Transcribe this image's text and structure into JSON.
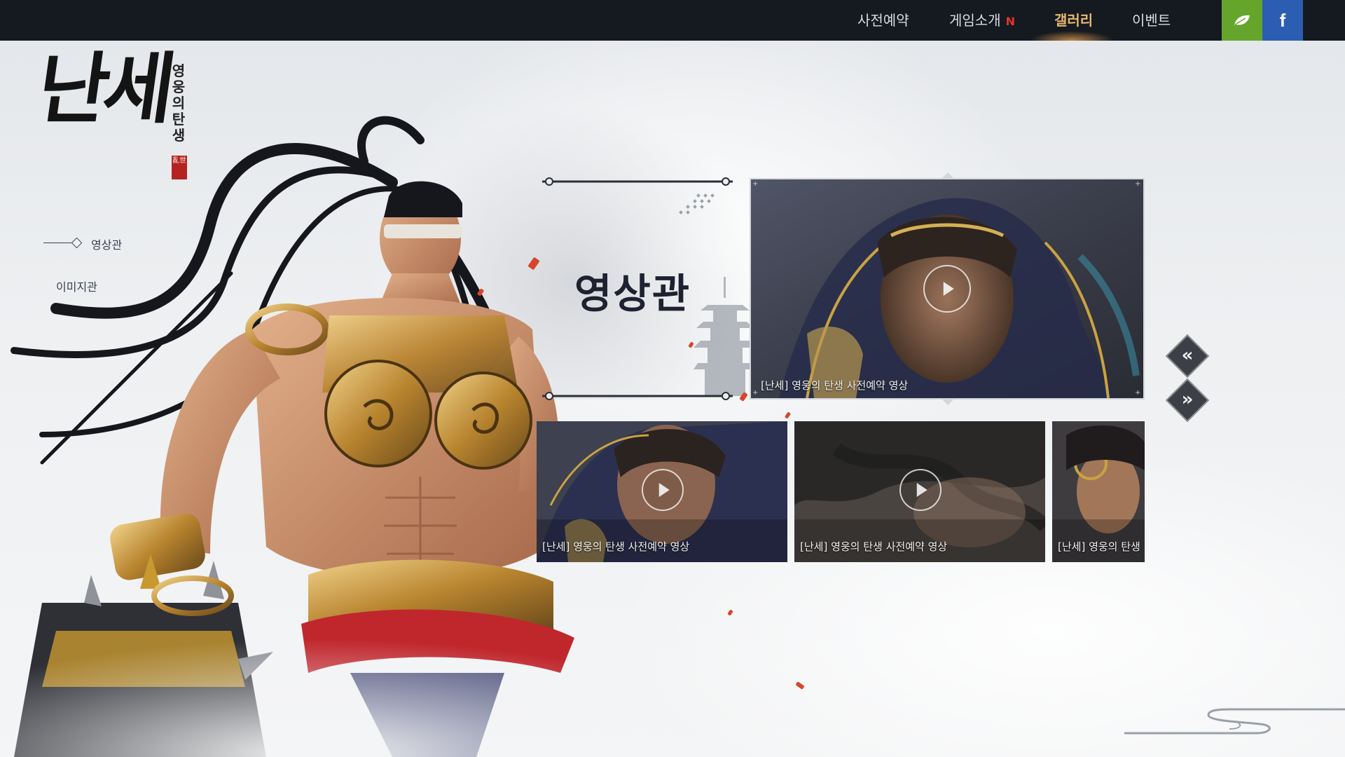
{
  "nav": {
    "items": [
      {
        "label": "사전예약"
      },
      {
        "label": "게임소개",
        "badge": "N"
      },
      {
        "label": "갤러리",
        "active": true
      },
      {
        "label": "이벤트"
      }
    ],
    "sns": [
      {
        "icon": "leaf-icon",
        "color": "#66a52c"
      },
      {
        "icon": "facebook-icon",
        "label": "f",
        "color": "#2b5db3"
      }
    ]
  },
  "logo": {
    "title": "난세",
    "subtitle": "영웅의탄생",
    "seal": "亂世"
  },
  "side_menu": {
    "items": [
      {
        "label": "영상관",
        "active": true
      },
      {
        "label": "이미지관",
        "active": false
      }
    ]
  },
  "section": {
    "title": "영상관"
  },
  "featured_video": {
    "caption": "[난세] 영웅의 탄생 사전예약 영상"
  },
  "carousel": {
    "prev_icon": "chevron-left-double-icon",
    "next_icon": "chevron-right-double-icon",
    "prev_glyph": "«",
    "next_glyph": "»"
  },
  "thumbnails": [
    {
      "caption": "[난세] 영웅의 탄생 사전예약 영상"
    },
    {
      "caption": "[난세] 영웅의 탄생 사전예약 영상"
    },
    {
      "caption": "[난세] 영웅의 탄생"
    }
  ],
  "colors": {
    "topbar": "#151920",
    "nav_active": "#e6b770",
    "new_badge": "#e2352b",
    "accent_red": "#d8452a"
  }
}
